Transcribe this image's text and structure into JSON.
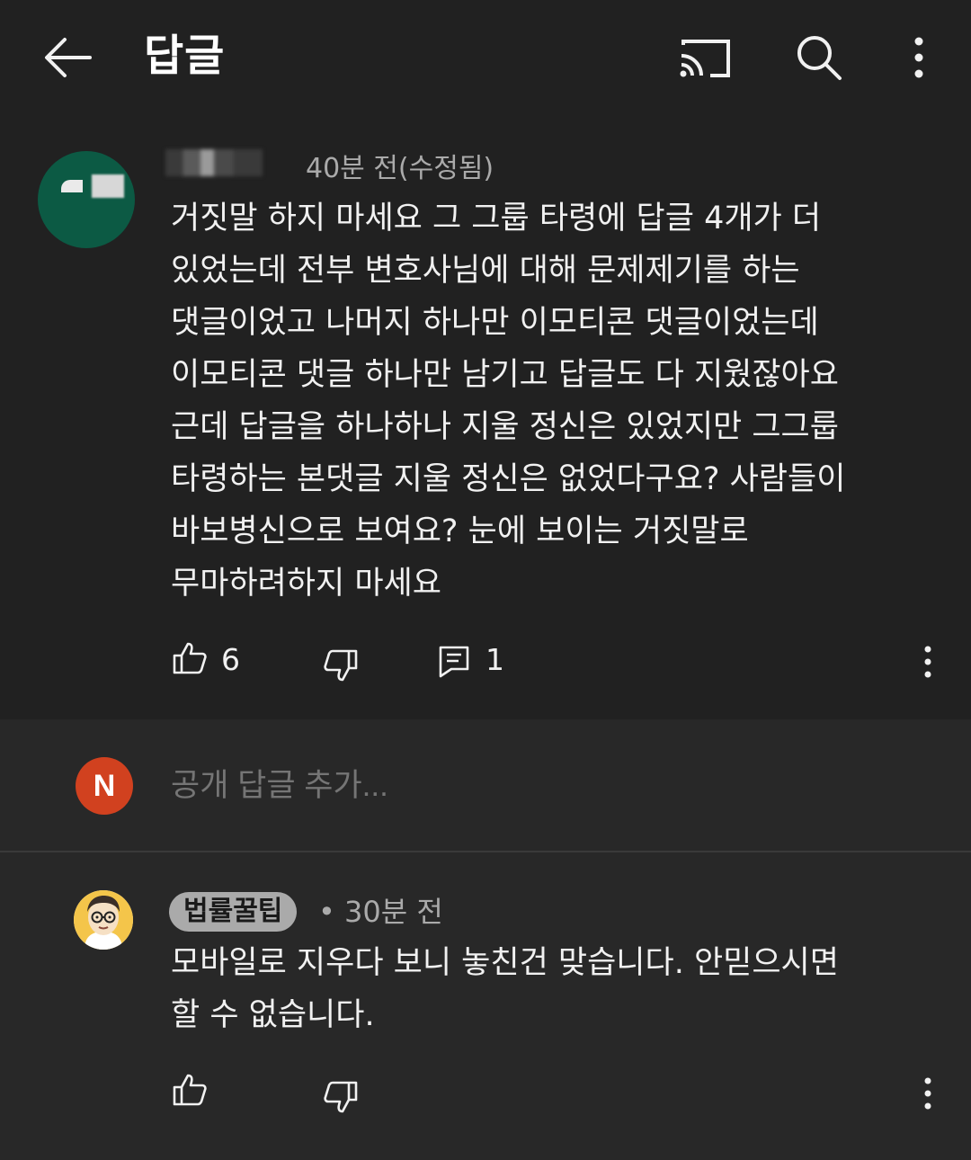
{
  "header": {
    "title": "답글",
    "icons": [
      "back-arrow-icon",
      "cast-icon",
      "search-icon",
      "more-vert-icon"
    ]
  },
  "parent_comment": {
    "time": "40분 전(수정됨)",
    "lines": [
      "거짓말 하지 마세요 그 그룹 타령에 답글 4개가 더",
      "있었는데 전부 변호사님에 대해 문제제기를 하는",
      "댓글이었고 나머지 하나만 이모티콘 댓글이었는데",
      "이모티콘 댓글 하나만 남기고 답글도 다 지웠잖아요",
      "근데 답글을 하나하나 지울 정신은 있었지만 그그룹",
      "타령하는 본댓글 지울 정신은 없었다구요? 사람들이",
      "바보병신으로 보여요? 눈에 보이는 거짓말로",
      "무마하려하지 마세요"
    ],
    "likes": "6",
    "replies": "1"
  },
  "reply_box": {
    "avatar_letter": "N",
    "placeholder": "공개 답글 추가..."
  },
  "reply": {
    "author": "법률꿀팁",
    "time": "• 30분 전",
    "lines": [
      "모바일로 지우다 보니 놓친건 맞습니다. 안믿으시면",
      "할 수 없습니다."
    ]
  },
  "colors": {
    "background": "#282828",
    "header": "#212121",
    "avatar_green": "#0c5a44",
    "avatar_n": "#d1411f"
  }
}
